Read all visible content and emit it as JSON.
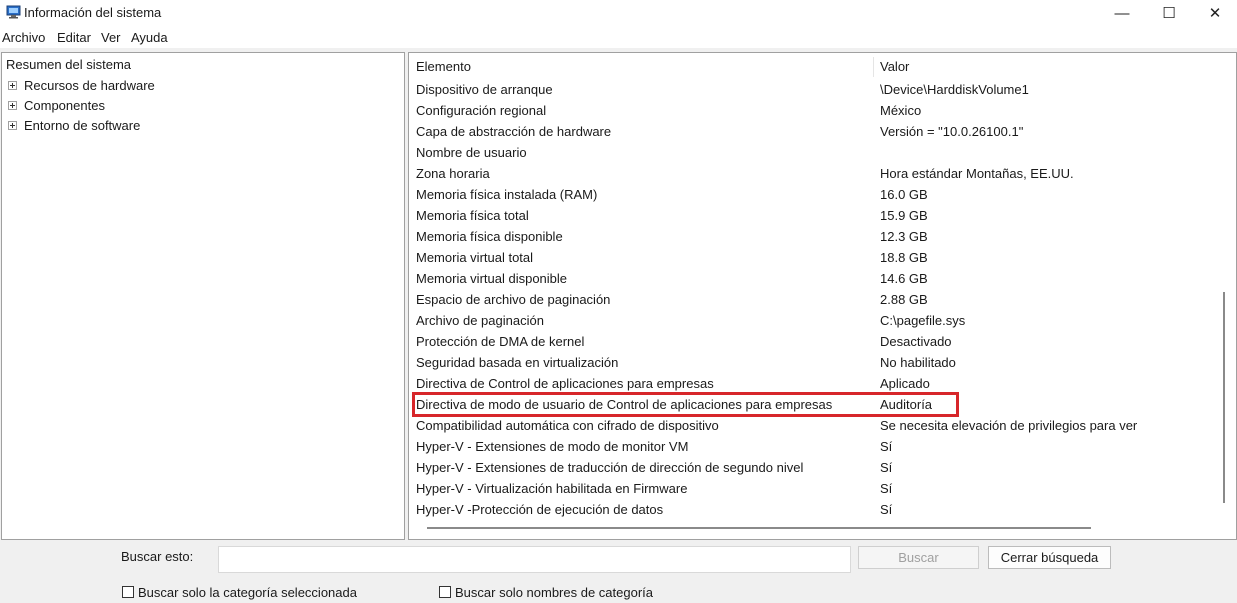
{
  "window": {
    "title": "Información del sistema",
    "minimize_glyph": "—",
    "maximize_glyph": "☐",
    "close_glyph": "✕"
  },
  "menu": [
    "Archivo",
    "Editar",
    "Ver",
    "Ayuda"
  ],
  "tree": {
    "root": "Resumen del sistema",
    "nodes": [
      "Recursos de hardware",
      "Componentes",
      "Entorno de software"
    ]
  },
  "list": {
    "headers": {
      "item": "Elemento",
      "value": "Valor"
    },
    "rows": [
      {
        "item": "Dispositivo de arranque",
        "value": "\\Device\\HarddiskVolume1"
      },
      {
        "item": "Configuración regional",
        "value": "México"
      },
      {
        "item": "Capa de abstracción de hardware",
        "value": "Versión = \"10.0.26100.1\""
      },
      {
        "item": "Nombre de usuario",
        "value": ""
      },
      {
        "item": "Zona horaria",
        "value": "Hora estándar Montañas, EE.UU."
      },
      {
        "item": "Memoria física instalada (RAM)",
        "value": "16.0 GB"
      },
      {
        "item": "Memoria física total",
        "value": "15.9 GB"
      },
      {
        "item": "Memoria física disponible",
        "value": "12.3 GB"
      },
      {
        "item": "Memoria virtual total",
        "value": "18.8 GB"
      },
      {
        "item": "Memoria virtual disponible",
        "value": "14.6 GB"
      },
      {
        "item": "Espacio de archivo de paginación",
        "value": "2.88 GB"
      },
      {
        "item": "Archivo de paginación",
        "value": "C:\\pagefile.sys"
      },
      {
        "item": "Protección de DMA de kernel",
        "value": "Desactivado"
      },
      {
        "item": "Seguridad basada en virtualización",
        "value": "No habilitado"
      },
      {
        "item": "Directiva de Control de aplicaciones para empresas",
        "value": "Aplicado"
      },
      {
        "item": "Directiva de modo de usuario de Control de aplicaciones para empresas",
        "value": "Auditoría"
      },
      {
        "item": "Compatibilidad automática con cifrado de dispositivo",
        "value": "Se necesita elevación de privilegios para ver"
      },
      {
        "item": "Hyper-V - Extensiones de modo de monitor VM",
        "value": "Sí"
      },
      {
        "item": "Hyper-V - Extensiones de traducción de dirección de segundo nivel",
        "value": "Sí"
      },
      {
        "item": "Hyper-V - Virtualización habilitada en Firmware",
        "value": "Sí"
      },
      {
        "item": "Hyper-V -Protección de ejecución de datos",
        "value": "Sí"
      }
    ],
    "highlight_color": "#d7262a"
  },
  "find": {
    "label": "Buscar esto:",
    "value": "",
    "find_button": "Buscar",
    "close_button": "Cerrar búsqueda",
    "checkbox_selected_category": "Buscar solo la categoría seleccionada",
    "checkbox_category_names": "Buscar solo nombres de categoría"
  }
}
